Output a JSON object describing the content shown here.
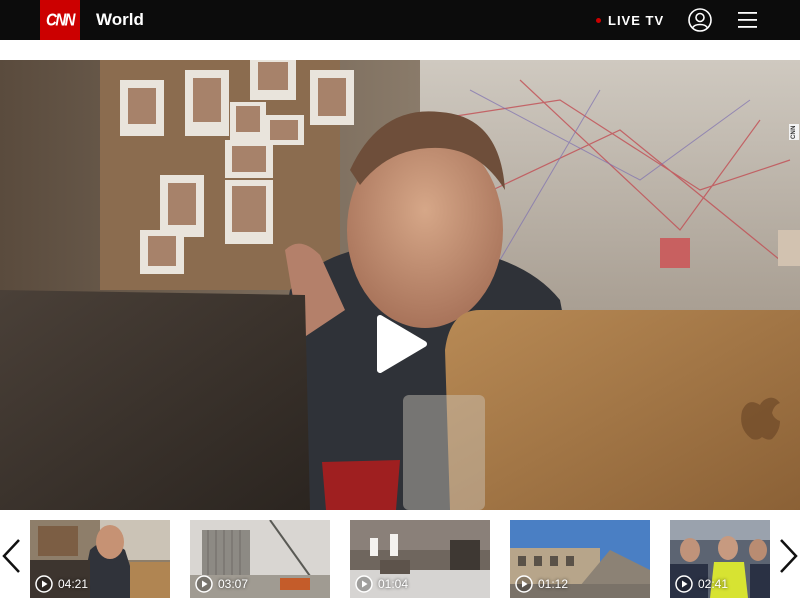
{
  "header": {
    "logo_text": "CNN",
    "section_title": "World",
    "live_tv_label": "LIVE TV",
    "brand_color": "#cc0000",
    "background_color": "#0c0c0c",
    "user_icon": "user-icon",
    "menu_icon": "hamburger-menu-icon"
  },
  "player": {
    "play_icon": "play-icon",
    "watermark_text": "CNN"
  },
  "carousel": {
    "prev_icon": "chevron-left-icon",
    "next_icon": "chevron-right-icon",
    "items": [
      {
        "duration": "04:21"
      },
      {
        "duration": "03:07"
      },
      {
        "duration": "01:04"
      },
      {
        "duration": "01:12"
      },
      {
        "duration": "02:41"
      }
    ]
  }
}
